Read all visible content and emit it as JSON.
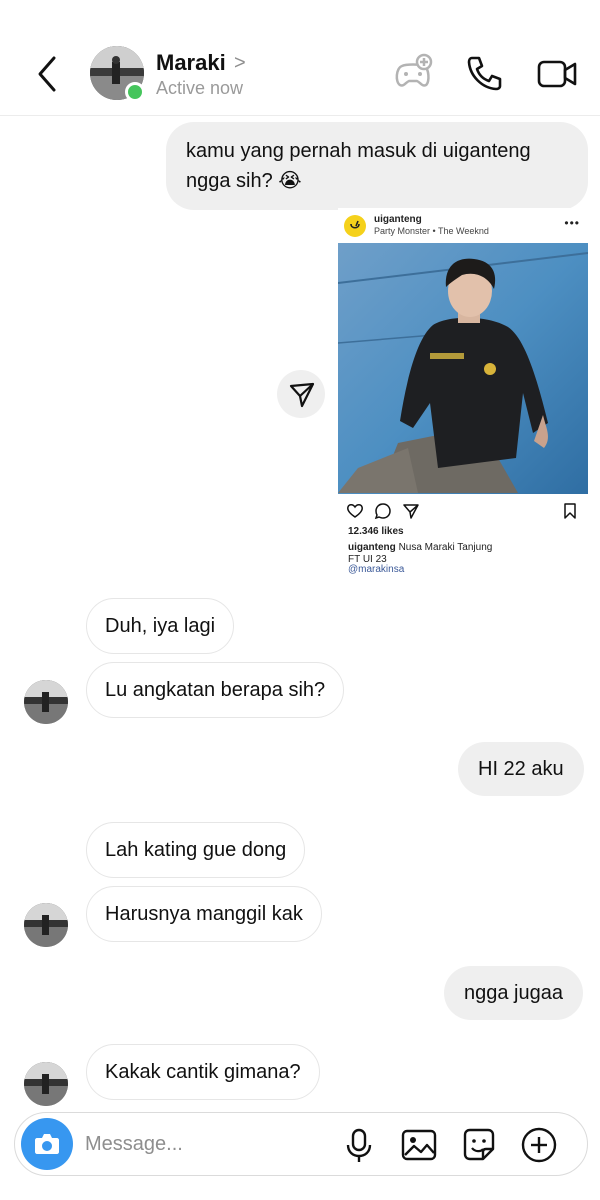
{
  "header": {
    "contact_name": "Maraki",
    "chevron": ">",
    "status": "Active now",
    "icons": [
      "back-arrow-icon",
      "game-controller-icon",
      "phone-icon",
      "video-camera-icon"
    ]
  },
  "messages": [
    {
      "side": "out",
      "text": "kamu yang pernah masuk di uiganteng ngga sih? 😭"
    },
    {
      "side": "in",
      "text": "Duh, iya lagi"
    },
    {
      "side": "in",
      "text": "Lu angkatan berapa sih?"
    },
    {
      "side": "out",
      "text": "HI 22 aku"
    },
    {
      "side": "in",
      "text": "Lah kating gue dong"
    },
    {
      "side": "in",
      "text": "Harusnya manggil kak"
    },
    {
      "side": "out",
      "text": "ngga jugaa"
    },
    {
      "side": "in",
      "text": "Kakak cantik gimana?"
    }
  ],
  "shared_post": {
    "username": "uiganteng",
    "song": "Party Monster • The Weeknd",
    "more": "•••",
    "likes": "12.346 likes",
    "caption_user": "uiganteng",
    "caption_text": "Nusa Maraki Tanjung",
    "caption_line2": "FT UI 23",
    "mention": "@marakinsa"
  },
  "composer": {
    "placeholder": "Message...",
    "icons": [
      "camera-icon",
      "microphone-icon",
      "gallery-icon",
      "sticker-icon",
      "plus-circle-icon"
    ]
  },
  "colors": {
    "accent": "#3797f0",
    "online": "#45c55c",
    "outgoing_bubble": "#efefef",
    "incoming_border": "#e6e6e6"
  }
}
